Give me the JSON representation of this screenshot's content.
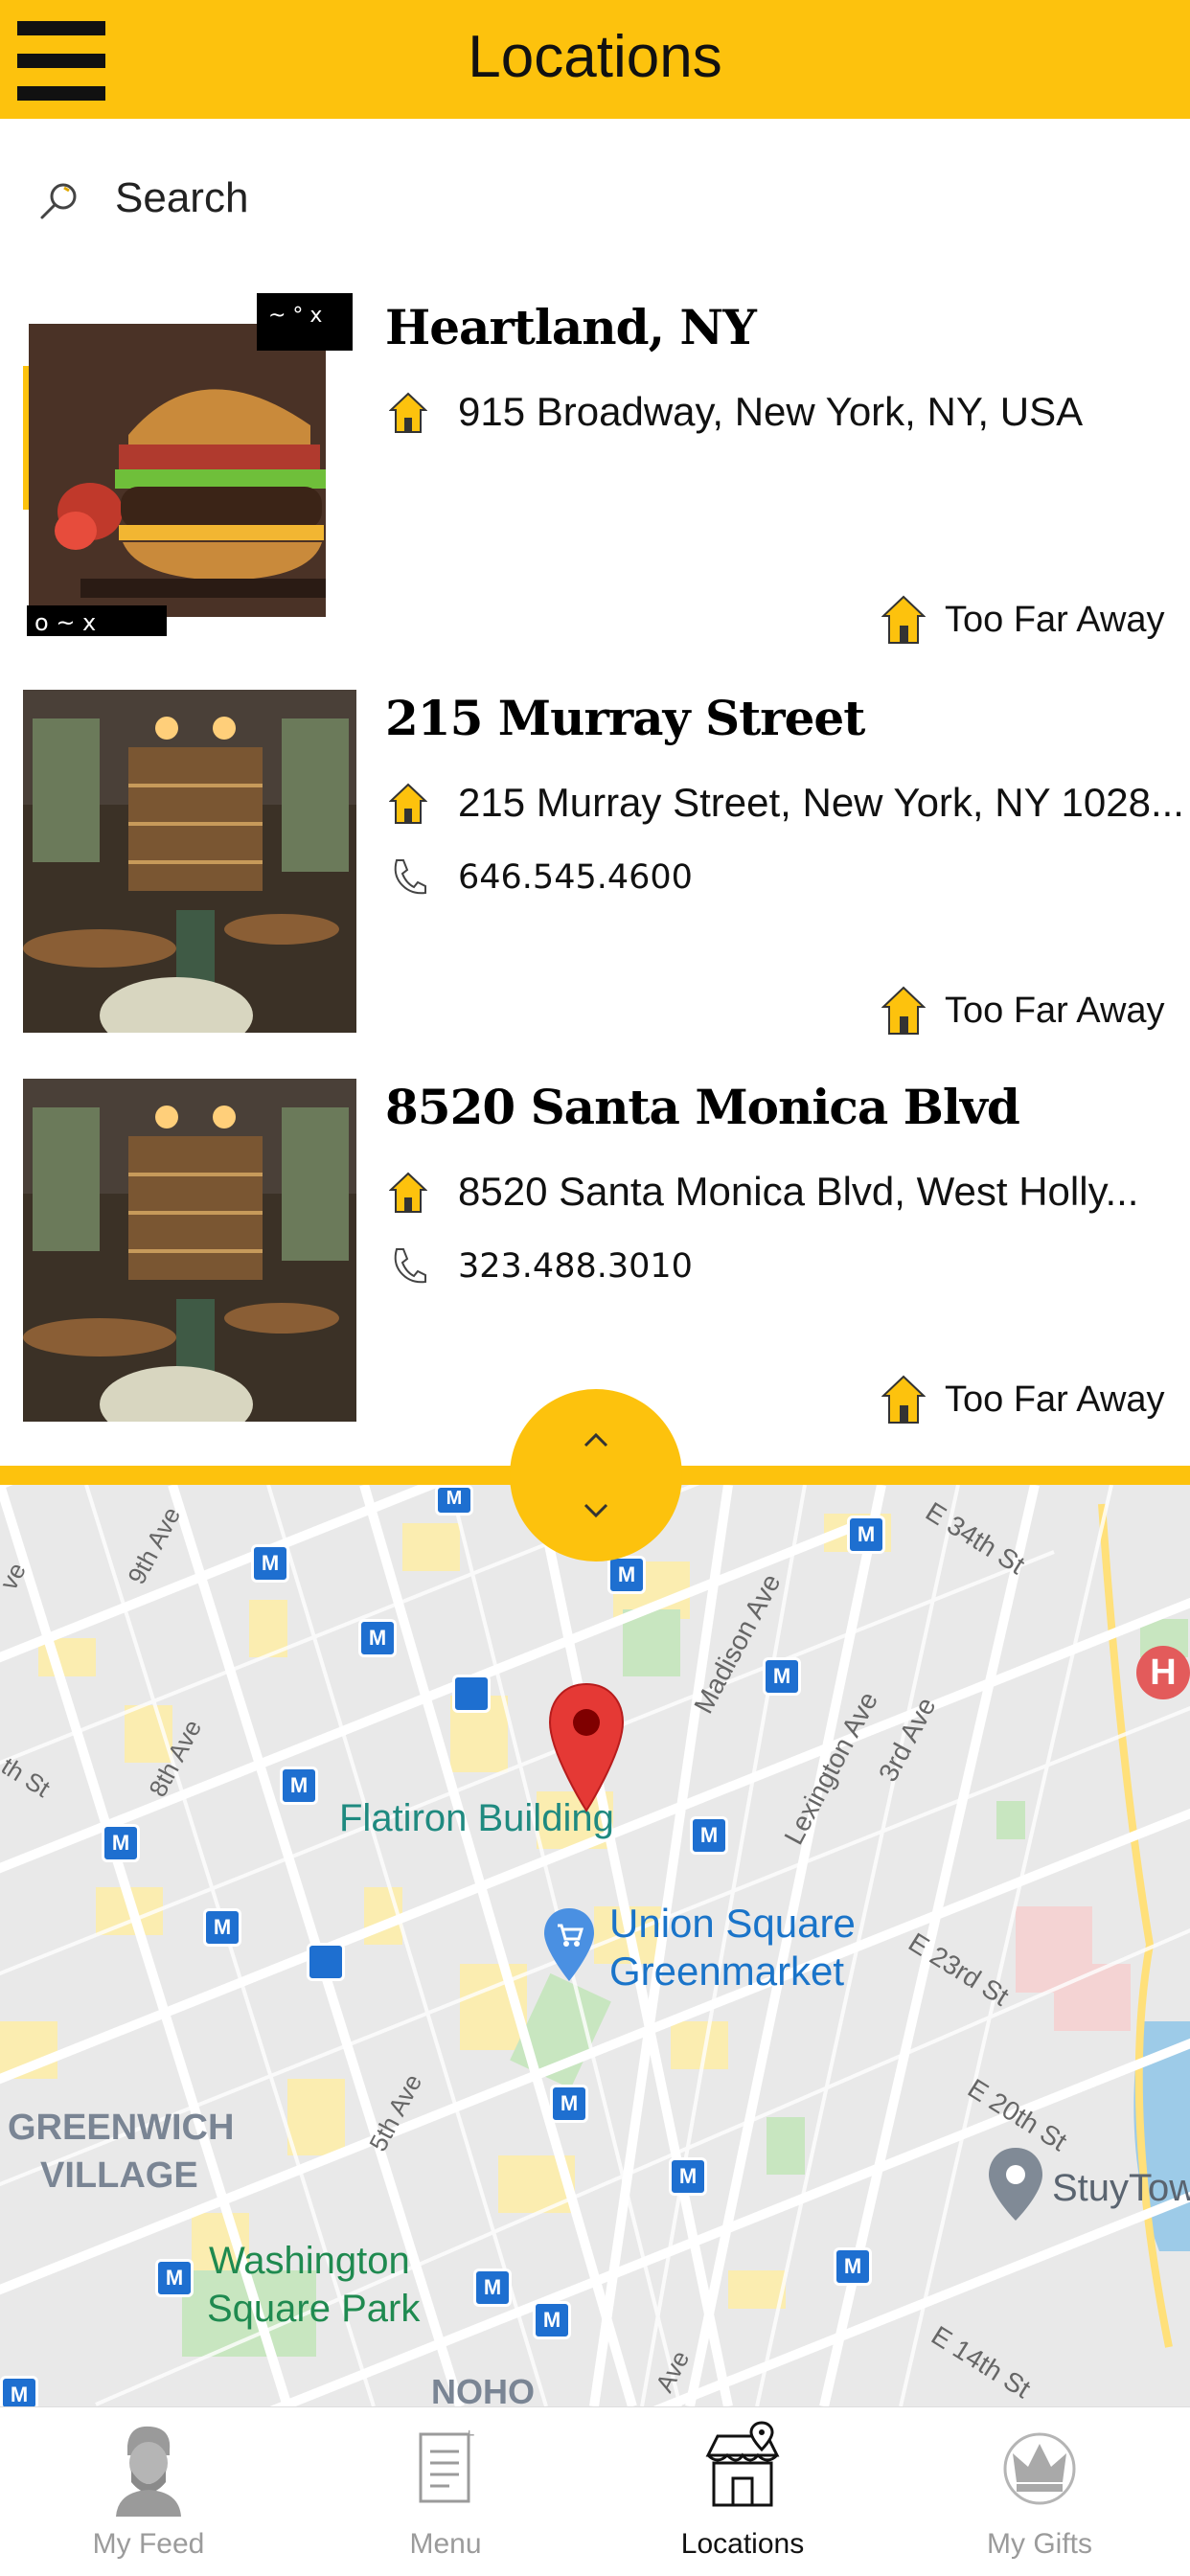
{
  "header": {
    "title": "Locations"
  },
  "search": {
    "placeholder": "Search",
    "value": ""
  },
  "locations": [
    {
      "name": "Heartland, NY",
      "address": "915 Broadway, New York, NY, USA",
      "phone": "",
      "status": "Too Far Away"
    },
    {
      "name": "215 Murray Street",
      "address": "215 Murray Street, New York, NY 1028...",
      "phone": "646.545.4600",
      "status": "Too Far Away"
    },
    {
      "name": "8520 Santa Monica Blvd",
      "address": "8520 Santa Monica Blvd, West Holly...",
      "phone": "323.488.3010",
      "status": "Too Far Away"
    }
  ],
  "map": {
    "streets": [
      "9th Ave",
      "8th Ave",
      "Madison Ave",
      "Lexington Ave",
      "3rd Ave",
      "E 34th St",
      "E 23rd St",
      "E 20th St",
      "5th Ave",
      "E 14th St",
      "Ave",
      "th St",
      "ve"
    ],
    "places": {
      "flatiron": "Flatiron Building",
      "union_square_1": "Union Square",
      "union_square_2": "Greenmarket",
      "greenwich_1": "GREENWICH",
      "greenwich_2": "VILLAGE",
      "washington_1": "Washington",
      "washington_2": "Square Park",
      "noho": "NOHO",
      "stuy": "StuyTow"
    },
    "hospital_glyph": "H",
    "transit_glyph": "M"
  },
  "tabs": [
    {
      "label": "My Feed",
      "icon": "avatar-icon",
      "active": false
    },
    {
      "label": "Menu",
      "icon": "menu-document-icon",
      "active": false
    },
    {
      "label": "Locations",
      "icon": "store-location-icon",
      "active": true
    },
    {
      "label": "My Gifts",
      "icon": "crown-icon",
      "active": false
    }
  ],
  "colors": {
    "accent": "#FDC20D",
    "map_pin": "#E53935",
    "transit": "#1E6FD0"
  }
}
